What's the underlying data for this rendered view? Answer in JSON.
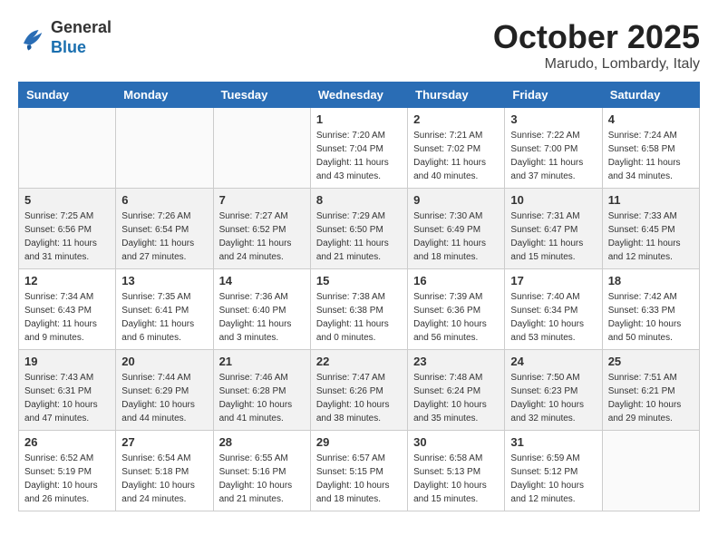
{
  "header": {
    "logo": {
      "line1": "General",
      "line2": "Blue"
    },
    "title": "October 2025",
    "subtitle": "Marudo, Lombardy, Italy"
  },
  "weekdays": [
    "Sunday",
    "Monday",
    "Tuesday",
    "Wednesday",
    "Thursday",
    "Friday",
    "Saturday"
  ],
  "weeks": [
    [
      {
        "day": "",
        "info": ""
      },
      {
        "day": "",
        "info": ""
      },
      {
        "day": "",
        "info": ""
      },
      {
        "day": "1",
        "info": "Sunrise: 7:20 AM\nSunset: 7:04 PM\nDaylight: 11 hours\nand 43 minutes."
      },
      {
        "day": "2",
        "info": "Sunrise: 7:21 AM\nSunset: 7:02 PM\nDaylight: 11 hours\nand 40 minutes."
      },
      {
        "day": "3",
        "info": "Sunrise: 7:22 AM\nSunset: 7:00 PM\nDaylight: 11 hours\nand 37 minutes."
      },
      {
        "day": "4",
        "info": "Sunrise: 7:24 AM\nSunset: 6:58 PM\nDaylight: 11 hours\nand 34 minutes."
      }
    ],
    [
      {
        "day": "5",
        "info": "Sunrise: 7:25 AM\nSunset: 6:56 PM\nDaylight: 11 hours\nand 31 minutes."
      },
      {
        "day": "6",
        "info": "Sunrise: 7:26 AM\nSunset: 6:54 PM\nDaylight: 11 hours\nand 27 minutes."
      },
      {
        "day": "7",
        "info": "Sunrise: 7:27 AM\nSunset: 6:52 PM\nDaylight: 11 hours\nand 24 minutes."
      },
      {
        "day": "8",
        "info": "Sunrise: 7:29 AM\nSunset: 6:50 PM\nDaylight: 11 hours\nand 21 minutes."
      },
      {
        "day": "9",
        "info": "Sunrise: 7:30 AM\nSunset: 6:49 PM\nDaylight: 11 hours\nand 18 minutes."
      },
      {
        "day": "10",
        "info": "Sunrise: 7:31 AM\nSunset: 6:47 PM\nDaylight: 11 hours\nand 15 minutes."
      },
      {
        "day": "11",
        "info": "Sunrise: 7:33 AM\nSunset: 6:45 PM\nDaylight: 11 hours\nand 12 minutes."
      }
    ],
    [
      {
        "day": "12",
        "info": "Sunrise: 7:34 AM\nSunset: 6:43 PM\nDaylight: 11 hours\nand 9 minutes."
      },
      {
        "day": "13",
        "info": "Sunrise: 7:35 AM\nSunset: 6:41 PM\nDaylight: 11 hours\nand 6 minutes."
      },
      {
        "day": "14",
        "info": "Sunrise: 7:36 AM\nSunset: 6:40 PM\nDaylight: 11 hours\nand 3 minutes."
      },
      {
        "day": "15",
        "info": "Sunrise: 7:38 AM\nSunset: 6:38 PM\nDaylight: 11 hours\nand 0 minutes."
      },
      {
        "day": "16",
        "info": "Sunrise: 7:39 AM\nSunset: 6:36 PM\nDaylight: 10 hours\nand 56 minutes."
      },
      {
        "day": "17",
        "info": "Sunrise: 7:40 AM\nSunset: 6:34 PM\nDaylight: 10 hours\nand 53 minutes."
      },
      {
        "day": "18",
        "info": "Sunrise: 7:42 AM\nSunset: 6:33 PM\nDaylight: 10 hours\nand 50 minutes."
      }
    ],
    [
      {
        "day": "19",
        "info": "Sunrise: 7:43 AM\nSunset: 6:31 PM\nDaylight: 10 hours\nand 47 minutes."
      },
      {
        "day": "20",
        "info": "Sunrise: 7:44 AM\nSunset: 6:29 PM\nDaylight: 10 hours\nand 44 minutes."
      },
      {
        "day": "21",
        "info": "Sunrise: 7:46 AM\nSunset: 6:28 PM\nDaylight: 10 hours\nand 41 minutes."
      },
      {
        "day": "22",
        "info": "Sunrise: 7:47 AM\nSunset: 6:26 PM\nDaylight: 10 hours\nand 38 minutes."
      },
      {
        "day": "23",
        "info": "Sunrise: 7:48 AM\nSunset: 6:24 PM\nDaylight: 10 hours\nand 35 minutes."
      },
      {
        "day": "24",
        "info": "Sunrise: 7:50 AM\nSunset: 6:23 PM\nDaylight: 10 hours\nand 32 minutes."
      },
      {
        "day": "25",
        "info": "Sunrise: 7:51 AM\nSunset: 6:21 PM\nDaylight: 10 hours\nand 29 minutes."
      }
    ],
    [
      {
        "day": "26",
        "info": "Sunrise: 6:52 AM\nSunset: 5:19 PM\nDaylight: 10 hours\nand 26 minutes."
      },
      {
        "day": "27",
        "info": "Sunrise: 6:54 AM\nSunset: 5:18 PM\nDaylight: 10 hours\nand 24 minutes."
      },
      {
        "day": "28",
        "info": "Sunrise: 6:55 AM\nSunset: 5:16 PM\nDaylight: 10 hours\nand 21 minutes."
      },
      {
        "day": "29",
        "info": "Sunrise: 6:57 AM\nSunset: 5:15 PM\nDaylight: 10 hours\nand 18 minutes."
      },
      {
        "day": "30",
        "info": "Sunrise: 6:58 AM\nSunset: 5:13 PM\nDaylight: 10 hours\nand 15 minutes."
      },
      {
        "day": "31",
        "info": "Sunrise: 6:59 AM\nSunset: 5:12 PM\nDaylight: 10 hours\nand 12 minutes."
      },
      {
        "day": "",
        "info": ""
      }
    ]
  ]
}
